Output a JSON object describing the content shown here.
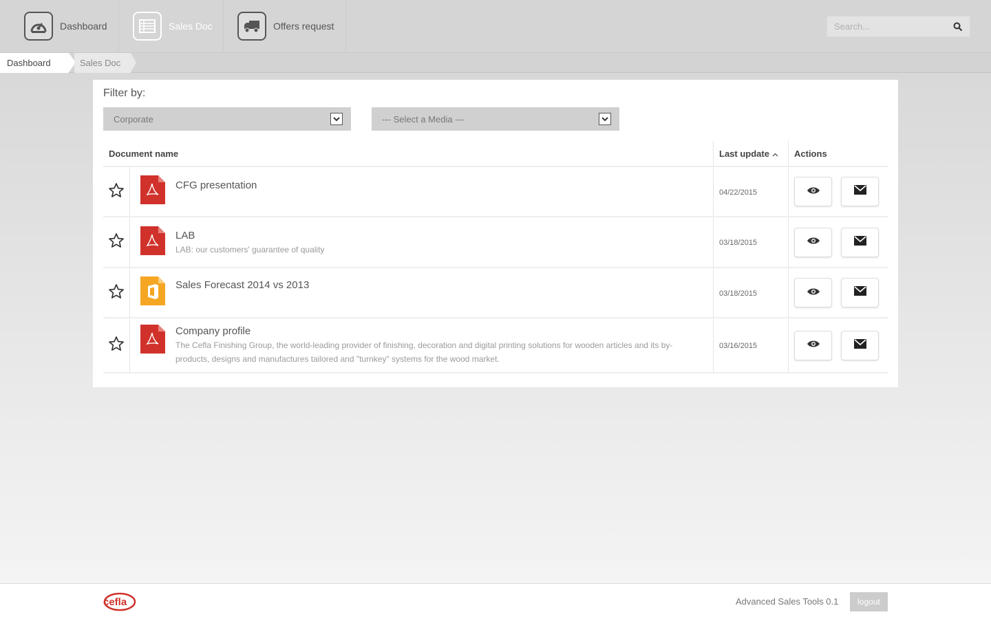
{
  "nav": {
    "items": [
      {
        "label": "Dashboard",
        "icon": "dashboard-gauge-icon"
      },
      {
        "label": "Sales Doc",
        "icon": "document-list-icon",
        "active": true
      },
      {
        "label": "Offers request",
        "icon": "truck-icon"
      }
    ],
    "search_placeholder": "Search..."
  },
  "breadcrumb": [
    "Dashboard",
    "Sales Doc"
  ],
  "filter": {
    "label": "Filter by:",
    "category_value": "Corporate",
    "media_value": "--- Select a Media ---"
  },
  "table": {
    "headers": {
      "name": "Document name",
      "date": "Last update",
      "actions": "Actions"
    },
    "rows": [
      {
        "title": "CFG presentation",
        "description": "",
        "date": "04/22/2015",
        "file_type": "pdf"
      },
      {
        "title": "LAB",
        "description": "LAB: our customers' guarantee of quality",
        "date": "03/18/2015",
        "file_type": "pdf"
      },
      {
        "title": "Sales Forecast 2014 vs 2013",
        "description": "",
        "date": "03/18/2015",
        "file_type": "office"
      },
      {
        "title": "Company profile",
        "description": "The Cefla Finishing Group, the world-leading provider of finishing, decoration and digital printing solutions for wooden articles and its by-products, designs and manufactures tailored and \"turnkey\" systems for the wood market.",
        "date": "03/16/2015",
        "file_type": "pdf"
      }
    ]
  },
  "footer": {
    "logo_text": "cefla",
    "version": "Advanced Sales Tools 0.1",
    "logout_label": "logout"
  },
  "colors": {
    "pdf": "#d0322b",
    "office": "#f5a623",
    "accent_logo": "#d0322b"
  }
}
